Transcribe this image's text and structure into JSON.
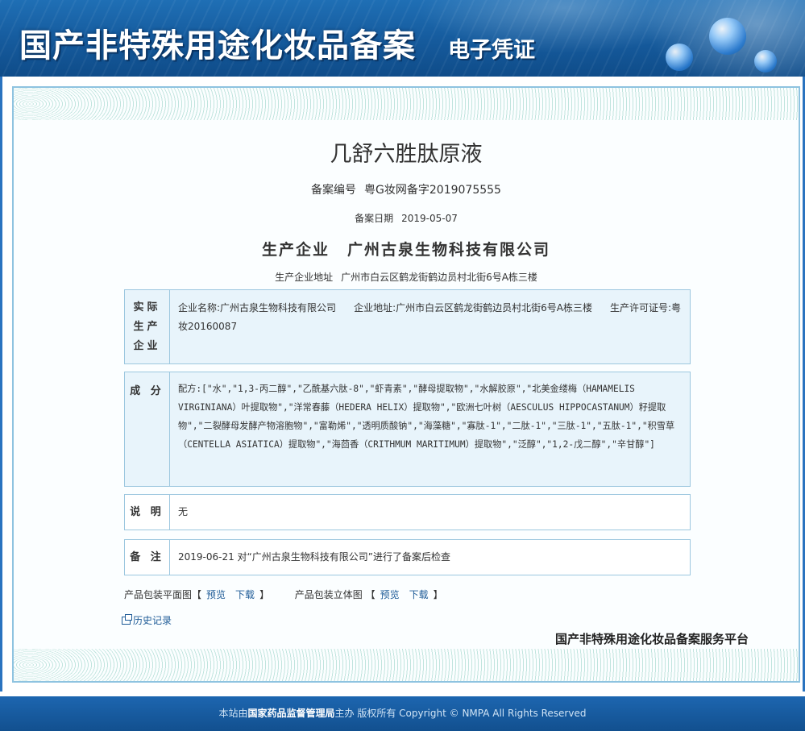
{
  "header": {
    "title": "国产非特殊用途化妆品备案",
    "subtitle": "电子凭证"
  },
  "product": {
    "name": "几舒六胜肽原液",
    "registration_label": "备案编号",
    "registration_number": "粤G妆网备字2019075555",
    "date_label": "备案日期",
    "date": "2019-05-07",
    "manufacturer_label": "生产企业",
    "manufacturer": "广州古泉生物科技有限公司",
    "manufacturer_address_label": "生产企业地址",
    "manufacturer_address": "广州市白云区鹤龙街鹤边员村北街6号A栋三楼"
  },
  "actual_enterprise": {
    "heading": "实际生产企业",
    "name_label": "企业名称:",
    "name": "广州古泉生物科技有限公司",
    "address_label": "企业地址:",
    "address": "广州市白云区鹤龙街鹤边员村北街6号A栋三楼",
    "license_label": "生产许可证号:",
    "license": "粤妆20160087"
  },
  "ingredients": {
    "heading": "成 分",
    "text": "配方:[\"水\",\"1,3-丙二醇\",\"乙酰基六肽-8\",\"虾青素\",\"酵母提取物\",\"水解胶原\",\"北美金缕梅（HAMAMELIS VIRGINIANA）叶提取物\",\"洋常春藤（HEDERA HELIX）提取物\",\"欧洲七叶树（AESCULUS HIPPOCASTANUM）籽提取物\",\"二裂酵母发酵产物溶胞物\",\"富勒烯\",\"透明质酸钠\",\"海藻糖\",\"寡肽-1\",\"二肽-1\",\"三肽-1\",\"五肽-1\",\"积雪草（CENTELLA ASIATICA）提取物\",\"海茴香（CRITHMUM MARITIMUM）提取物\",\"泛醇\",\"1,2-戊二醇\",\"辛甘醇\"]"
  },
  "note": {
    "heading": "说 明",
    "text": "无"
  },
  "remark": {
    "heading": "备 注",
    "text": "2019-06-21 对“广州古泉生物科技有限公司”进行了备案后检查"
  },
  "package": {
    "flat_label": "产品包装平面图",
    "solid_label": "产品包装立体图",
    "bracket_open": "【",
    "bracket_close": "】",
    "preview": "预览",
    "download": "下载"
  },
  "history_label": "历史记录",
  "platform_label": "国产非特殊用途化妆品备案服务平台",
  "footer": {
    "prefix": "本站由",
    "org": "国家药品监督管理局",
    "suffix": "主办 版权所有 Copyright © NMPA All Rights Reserved"
  },
  "colors": {
    "header_blue": "#155a9c",
    "frame_border": "#2a73bf",
    "box_border": "#9cc7df",
    "box_fill": "#e8f4fb",
    "link": "#1e5b97"
  }
}
